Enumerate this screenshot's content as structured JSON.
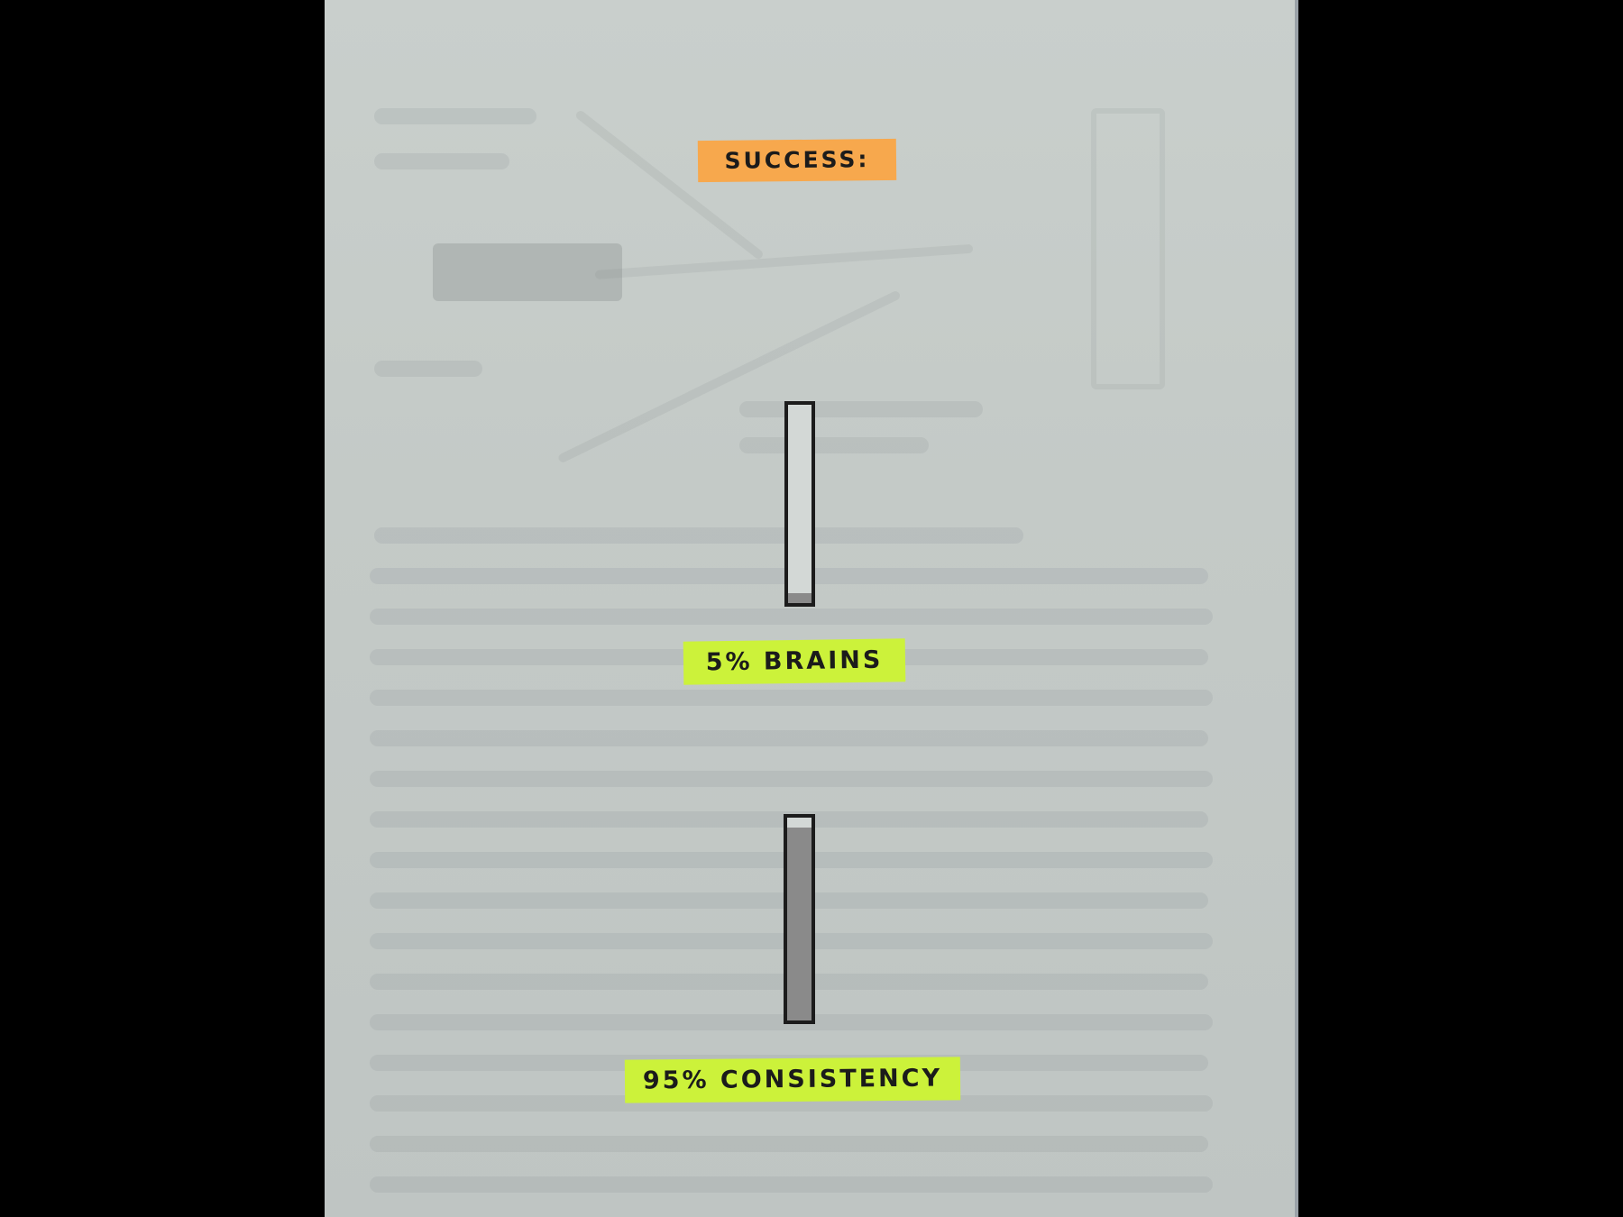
{
  "success_label": "SUCCESS:",
  "items": [
    {
      "label": "5% BRAINS",
      "percent": 5
    },
    {
      "label": "95% CONSISTENCY",
      "percent": 95
    }
  ],
  "colors": {
    "success_highlight": "#f7a84d",
    "item_highlight": "#ccf23a",
    "gauge_fill": "#8a8a8a",
    "gauge_border": "#1c1c1c"
  }
}
